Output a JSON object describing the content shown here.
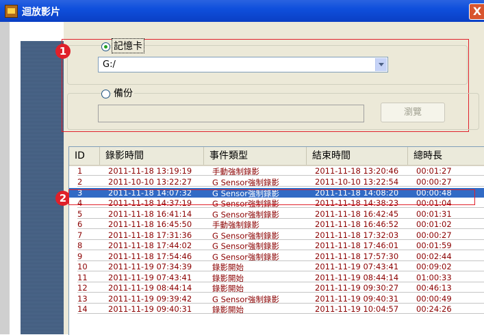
{
  "window": {
    "title": "迴放影片",
    "close_glyph": "X"
  },
  "source": {
    "memory_card": {
      "label": "記憶卡",
      "selected": true,
      "path": "G:/"
    },
    "backup": {
      "label": "備份",
      "selected": false,
      "path": "",
      "browse_label": "瀏覽"
    }
  },
  "badges": [
    "1",
    "2"
  ],
  "table": {
    "columns": [
      "ID",
      "錄影時間",
      "事件類型",
      "結束時間",
      "總時長"
    ],
    "selected_index": 2,
    "rows": [
      [
        "1",
        "2011-11-18 13:19:19",
        "手動強制錄影",
        "2011-11-18 13:20:46",
        "00:01:27"
      ],
      [
        "2",
        "2011-10-10 13:22:27",
        "G Sensor強制錄影",
        "2011-10-10 13:22:54",
        "00:00:27"
      ],
      [
        "3",
        "2011-11-18 14:07:32",
        "G Sensor強制錄影",
        "2011-11-18 14:08:20",
        "00:00:48"
      ],
      [
        "4",
        "2011-11-18 14:37:19",
        "G Sensor強制錄影",
        "2011-11-18 14:38:23",
        "00:01:04"
      ],
      [
        "5",
        "2011-11-18 16:41:14",
        "G Sensor強制錄影",
        "2011-11-18 16:42:45",
        "00:01:31"
      ],
      [
        "6",
        "2011-11-18 16:45:50",
        "手動強制錄影",
        "2011-11-18 16:46:52",
        "00:01:02"
      ],
      [
        "7",
        "2011-11-18 17:31:36",
        "G Sensor強制錄影",
        "2011-11-18 17:32:03",
        "00:00:27"
      ],
      [
        "8",
        "2011-11-18 17:44:02",
        "G Sensor強制錄影",
        "2011-11-18 17:46:01",
        "00:01:59"
      ],
      [
        "9",
        "2011-11-18 17:54:46",
        "G Sensor強制錄影",
        "2011-11-18 17:57:30",
        "00:02:44"
      ],
      [
        "10",
        "2011-11-19 07:34:39",
        "錄影開始",
        "2011-11-19 07:43:41",
        "00:09:02"
      ],
      [
        "11",
        "2011-11-19 07:43:41",
        "錄影開始",
        "2011-11-19 08:44:14",
        "01:00:33"
      ],
      [
        "12",
        "2011-11-19 08:44:14",
        "錄影開始",
        "2011-11-19 09:30:27",
        "00:46:13"
      ],
      [
        "13",
        "2011-11-19 09:39:42",
        "G Sensor強制錄影",
        "2011-11-19 09:40:31",
        "00:00:49"
      ],
      [
        "14",
        "2011-11-19 09:40:31",
        "錄影開始",
        "2011-11-19 10:04:57",
        "00:24:26"
      ]
    ]
  }
}
